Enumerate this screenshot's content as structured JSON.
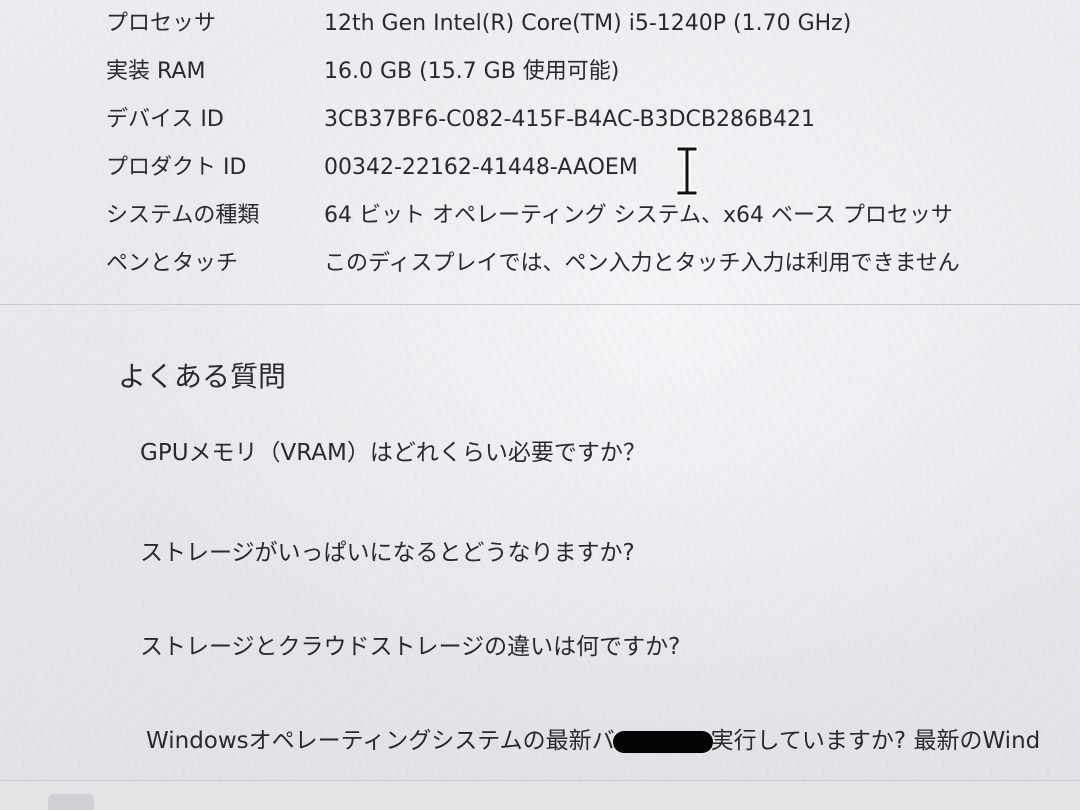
{
  "specs": [
    {
      "label": "プロセッサ",
      "value": "12th Gen Intel(R) Core(TM) i5-1240P (1.70 GHz)"
    },
    {
      "label": "実装 RAM",
      "value": "16.0 GB (15.7 GB 使用可能)"
    },
    {
      "label": "デバイス ID",
      "value": "3CB37BF6-C082-415F-B4AC-B3DCB286B421"
    },
    {
      "label": "プロダクト ID",
      "value": "00342-22162-41448-AAOEM"
    },
    {
      "label": "システムの種類",
      "value": "64 ビット オペレーティング システム、x64 ベース プロセッサ"
    },
    {
      "label": "ペンとタッチ",
      "value": "このディスプレイでは、ペン入力とタッチ入力は利用できません"
    }
  ],
  "faq": {
    "title": "よくある質問",
    "items": [
      "GPUメモリ（VRAM）はどれくらい必要ですか？",
      "ストレージがいっぱいになるとどうなりますか?",
      "ストレージとクラウドストレージの違いは何ですか?"
    ],
    "last_item_before": "Windowsオペレーティングシステムの最新バ",
    "last_item_after": "実行していますか? 最新のWind"
  },
  "cursor_icon": "text-cursor-icon",
  "colors": {
    "background": "#e9e9ea",
    "text": "#2a2a2e",
    "redaction": "#050505"
  }
}
